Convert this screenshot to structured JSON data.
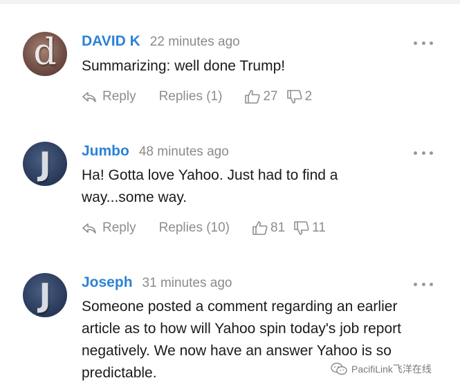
{
  "comments": [
    {
      "avatar_letter": "d",
      "username": "DAVID K",
      "time": "22 minutes ago",
      "text": "Summarizing: well done Trump!",
      "reply_label": "Reply",
      "replies_label": "Replies (1)",
      "likes": "27",
      "dislikes": "2"
    },
    {
      "avatar_letter": "J",
      "username": "Jumbo",
      "time": "48 minutes ago",
      "text": "Ha! Gotta love Yahoo. Just had to find a way...some way.",
      "reply_label": "Reply",
      "replies_label": "Replies (10)",
      "likes": "81",
      "dislikes": "11"
    },
    {
      "avatar_letter": "J",
      "username": "Joseph",
      "time": "31 minutes ago",
      "text": "Someone posted a comment regarding an earlier article as to how will Yahoo spin today's job report negatively. We now have an answer Yahoo is so predictable."
    }
  ],
  "watermark": "PacifiLink飞洋在线",
  "colors": {
    "username": "#2b82d4",
    "meta": "#8a8a8a",
    "action": "#8d8d8d"
  }
}
